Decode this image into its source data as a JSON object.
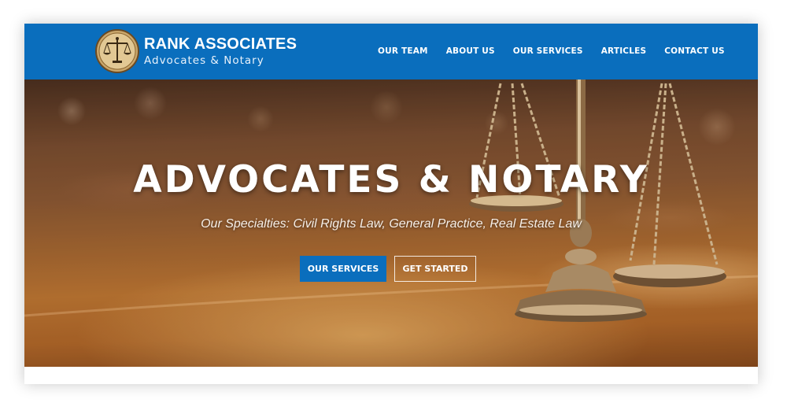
{
  "brand": {
    "title": "RANK ASSOCIATES",
    "subtitle": "Advocates & Notary",
    "logo_icon": "balance-scale-icon"
  },
  "nav": {
    "items": [
      {
        "label": "OUR TEAM"
      },
      {
        "label": "ABOUT US"
      },
      {
        "label": "OUR SERVICES"
      },
      {
        "label": "ARTICLES"
      },
      {
        "label": "CONTACT US"
      }
    ]
  },
  "hero": {
    "title": "ADVOCATES & NOTARY",
    "subtitle": "Our Specialties: Civil Rights Law, General Practice, Real Estate Law",
    "primary_button": "OUR SERVICES",
    "secondary_button": "GET STARTED",
    "background_image": "scales-of-justice-on-wooden-desk"
  },
  "colors": {
    "brand_blue": "#0a6ebd",
    "white": "#ffffff"
  }
}
